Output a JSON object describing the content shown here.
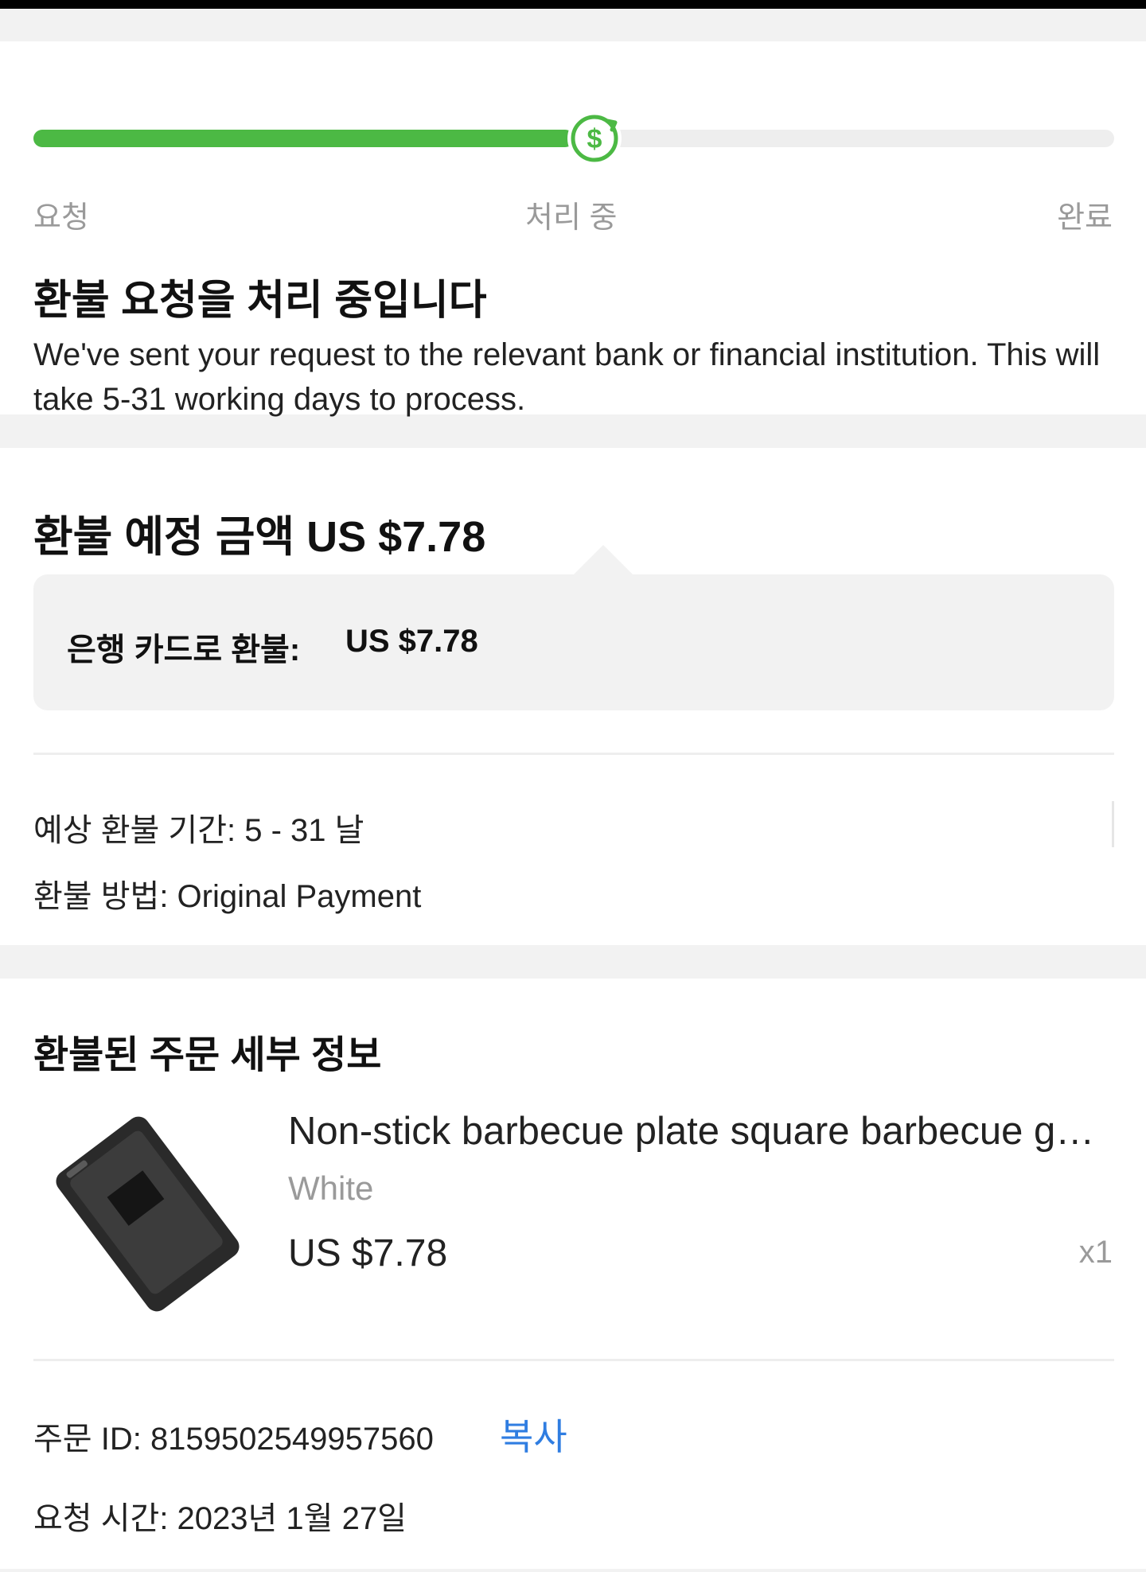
{
  "progress": {
    "fraction": 0.5,
    "accent": "#4cb944",
    "steps": [
      "요청",
      "처리 중",
      "완료"
    ],
    "current_icon": "refund-dollar-icon"
  },
  "status": {
    "title": "환불 요청을 처리 중입니다",
    "description": "We've sent your request to the relevant bank or financial institution. This will take 5-31 working days to process."
  },
  "refund": {
    "title": "환불 예정 금액 US $7.78",
    "method_label": "은행 카드로 환불:",
    "method_amount": "US $7.78",
    "period": "예상 환불 기간: 5 - 31 날",
    "payment_method": "환불 방법: Original Payment"
  },
  "order": {
    "title": "환불된 주문 세부 정보",
    "product": {
      "name": "Non-stick barbecue plate square barbecue grill mat",
      "variant": "White",
      "price": "US $7.78",
      "quantity": "x1"
    },
    "order_id": "주문 ID: 8159502549957560",
    "copy_label": "복사",
    "copy_color": "#2f7de1",
    "request_time": "요청 시간: 2023년 1월 27일"
  }
}
